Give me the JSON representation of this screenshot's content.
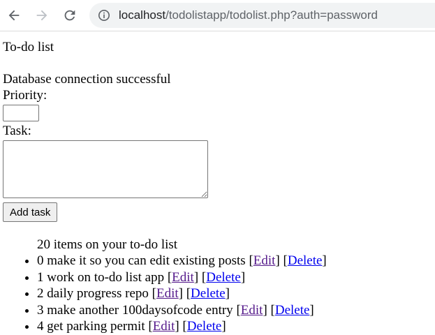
{
  "browser": {
    "url_host": "localhost",
    "url_rest": "/todolistapp/todolist.php?auth=password",
    "back_icon": "arrow-left-icon",
    "forward_icon": "arrow-right-icon",
    "reload_icon": "reload-icon",
    "info_icon": "info-icon"
  },
  "page": {
    "title": "To-do list",
    "status": "Database connection successful",
    "priority_label": "Priority:",
    "priority_value": "",
    "task_label": "Task:",
    "task_value": "",
    "add_button": "Add task",
    "count_text": "20 items on your to-do list"
  },
  "items": [
    {
      "priority": "0",
      "text": "make it so you can edit existing posts",
      "edit": "Edit",
      "delete": "Delete"
    },
    {
      "priority": "1",
      "text": "work on to-do list app",
      "edit": "Edit",
      "delete": "Delete"
    },
    {
      "priority": "2",
      "text": "daily progress repo",
      "edit": "Edit",
      "delete": "Delete"
    },
    {
      "priority": "3",
      "text": "make another 100daysofcode entry",
      "edit": "Edit",
      "delete": "Delete"
    },
    {
      "priority": "4",
      "text": "get parking permit",
      "edit": "Edit",
      "delete": "Delete"
    }
  ],
  "colors": {
    "visited_link": "#551a8b",
    "link": "#0000ee",
    "omnibox_bg": "#f1f3f4"
  }
}
